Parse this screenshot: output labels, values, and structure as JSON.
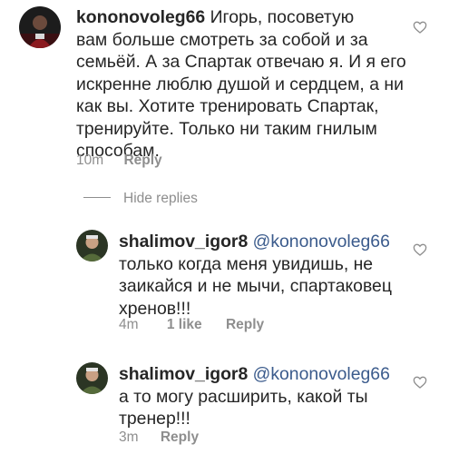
{
  "comments": [
    {
      "username": "kononovoleg66",
      "lines": [
        "Игорь, посоветую",
        "вам больше смотреть за собой и за",
        "семьёй. А за Спартак отвечаю я. И я его",
        "искренне люблю душой и сердцем, а ни",
        "как вы. Хотите тренировать Спартак,",
        "тренируйте. Только ни таким гнилым",
        "способам."
      ],
      "time": "10m",
      "reply_label": "Reply"
    }
  ],
  "hide_replies_label": "Hide replies",
  "replies": [
    {
      "username": "shalimov_igor8",
      "mention": "@kononovoleg66",
      "lines": [
        "только когда меня увидишь, не",
        "заикайся и не мычи, спартаковец",
        "хренов!!!"
      ],
      "time": "4m",
      "likes": "1 like",
      "reply_label": "Reply"
    },
    {
      "username": "shalimov_igor8",
      "mention": "@kononovoleg66",
      "lines": [
        "а то могу расширить, какой ты",
        "тренер!!!"
      ],
      "time": "3m",
      "reply_label": "Reply"
    }
  ],
  "colors": {
    "text": "#262626",
    "meta": "#8e8e8e",
    "mention": "#3b5b8c"
  },
  "icons": {
    "like": "heart-outline-icon"
  }
}
